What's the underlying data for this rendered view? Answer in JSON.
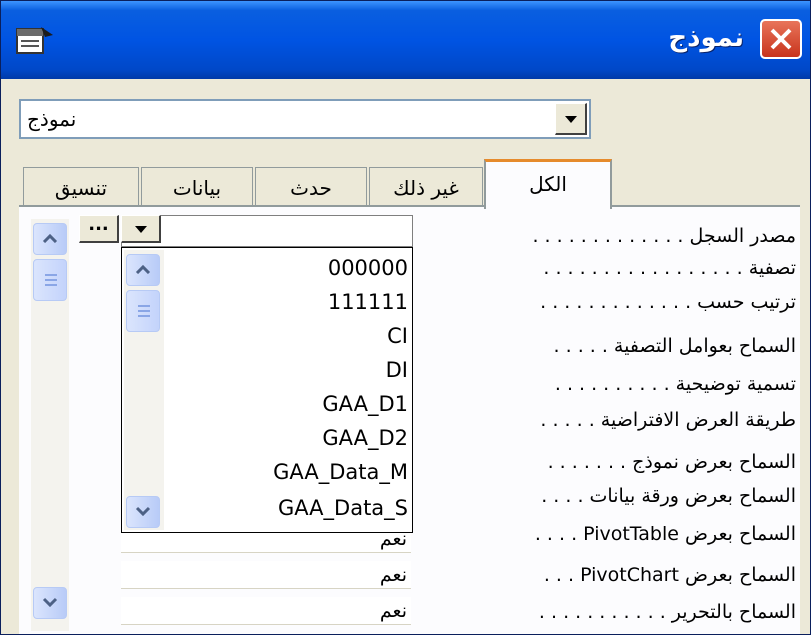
{
  "window": {
    "title": "نموذج"
  },
  "selector": {
    "value": "نموذج"
  },
  "tabs": [
    {
      "label": "الكل",
      "active": true
    },
    {
      "label": "غير ذلك",
      "active": false
    },
    {
      "label": "حدث",
      "active": false
    },
    {
      "label": "بيانات",
      "active": false
    },
    {
      "label": "تنسيق",
      "active": false
    }
  ],
  "properties": [
    {
      "label": "مصدر السجل . . . . . . . . . . . . .",
      "value": ""
    },
    {
      "label": "تصفية . . . . . . . . . . . . . . . . .",
      "value": ""
    },
    {
      "label": "ترتيب حسب . . . . . . . . . . . . .",
      "value": ""
    },
    {
      "label": "السماح بعوامل التصفية . . . . .",
      "value": ""
    },
    {
      "label": "تسمية توضيحية . . . . . . . . . .",
      "value": ""
    },
    {
      "label": "طريقة العرض الافتراضية . . . . .",
      "value": ""
    },
    {
      "label": "السماح بعرض نموذج . . . . . . .",
      "value": ""
    },
    {
      "label": "السماح بعرض ورقة بيانات . . . .",
      "value": ""
    },
    {
      "label": "السماح بعرض PivotTable . . . .",
      "value": "نعم"
    },
    {
      "label": "السماح بعرض PivotChart . . .",
      "value": "نعم"
    },
    {
      "label": "السماح بالتحرير . . . . . . . . . . .",
      "value": "نعم"
    }
  ],
  "record_source": {
    "build_label": "...",
    "options": [
      "000000",
      "111111",
      "CI",
      "DI",
      "GAA_D1",
      "GAA_D2",
      "GAA_Data_M",
      "GAA_Data_S"
    ]
  },
  "icons": {
    "close": "close-icon",
    "app": "properties-sheet-icon",
    "dropdown": "chevron-down-icon"
  }
}
